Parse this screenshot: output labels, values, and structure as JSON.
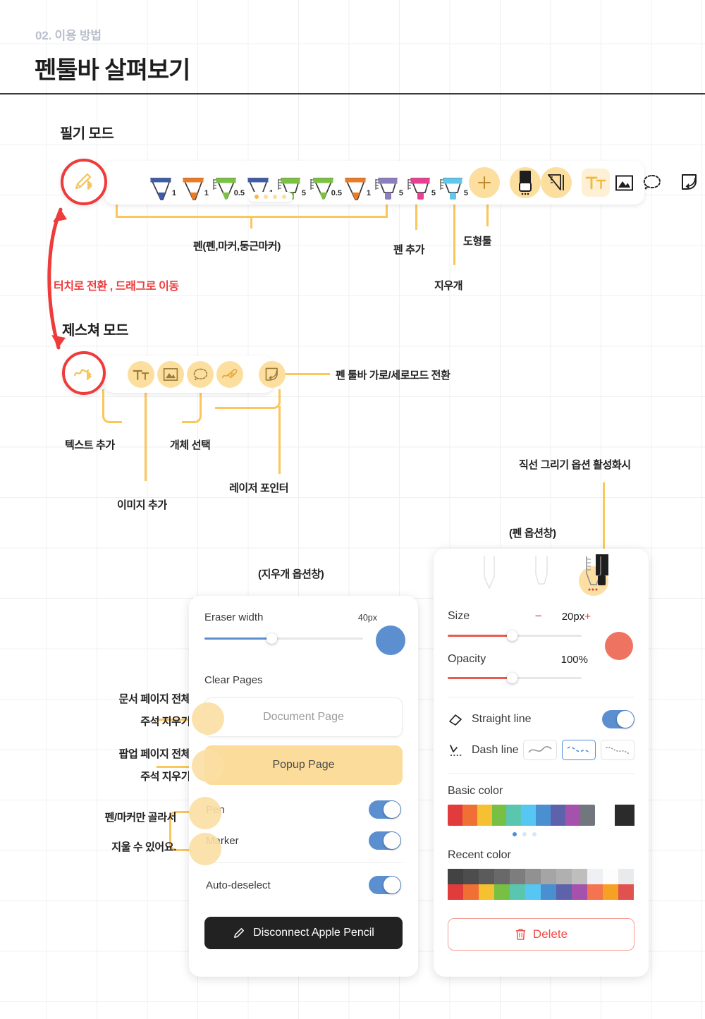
{
  "header": {
    "kicker": "02. 이용 방법",
    "title": "펜툴바 살펴보기"
  },
  "sections": {
    "writing_mode": "필기 모드",
    "gesture_mode": "제스쳐 모드"
  },
  "pen_toolbar": {
    "mode_icon": "pen-bluetooth-icon",
    "pens": [
      {
        "name": "pen",
        "color": "#3f5ca8",
        "size": "1",
        "type": "pen"
      },
      {
        "name": "pen",
        "color": "#ef7a21",
        "size": "1",
        "type": "pen"
      },
      {
        "name": "round-marker",
        "color": "#7cc242",
        "size": "0.5",
        "type": "round"
      },
      {
        "name": "pen",
        "color": "#3f5ca8",
        "size": "1",
        "type": "pen"
      },
      {
        "name": "marker",
        "color": "#7cc242",
        "size": "5",
        "type": "marker"
      },
      {
        "name": "round-marker",
        "color": "#7cc242",
        "size": "0.5",
        "type": "round"
      },
      {
        "name": "pen",
        "color": "#ef7a21",
        "size": "1",
        "type": "pen"
      },
      {
        "name": "marker",
        "color": "#8d7ec0",
        "size": "5",
        "type": "marker"
      },
      {
        "name": "marker",
        "color": "#ea3f93",
        "size": "5",
        "type": "marker"
      },
      {
        "name": "marker",
        "color": "#5ec8ee",
        "size": "5",
        "type": "marker"
      }
    ],
    "pager_dots": {
      "count": 4,
      "active_index": 0
    },
    "add_pen": "plus-icon",
    "eraser": "eraser-icon",
    "shape_tool": "ruler-triangle-icon",
    "text_tool": "text-tt-icon",
    "image_tool": "image-icon",
    "lasso_tool": "lasso-icon",
    "orientation_tool": "toolbar-orientation-icon"
  },
  "gesture_toolbar": {
    "mode_icon": "gesture-bluetooth-icon",
    "items": [
      {
        "name": "text-tt-icon"
      },
      {
        "name": "image-icon"
      },
      {
        "name": "lasso-icon"
      },
      {
        "name": "laser-pointer-icon"
      },
      {
        "name": "toolbar-orientation-icon"
      }
    ]
  },
  "annotations": {
    "pen_group": "펜(펜,마커,둥근마커)",
    "touch_switch": "터치로 전환 , 드래그로 이동",
    "add_pen": "펜 추가",
    "eraser": "지우개",
    "shape_tool": "도형툴",
    "toolbar_orientation": "펜 툴바 가로/세로모드 전환",
    "add_text": "텍스트 추가",
    "select_object": "개체 선택",
    "add_image": "이미지 추가",
    "laser_pointer": "레이저 포인터",
    "straight_line_enabled": "직선 그리기 옵션 활성화시",
    "pen_panel_caption": "(펜 옵션창)",
    "eraser_panel_caption": "(지우개 옵션창)",
    "clear_document_page": "문서 페이지 전체\n주석 지우기",
    "clear_document_page_l1": "문서 페이지 전체",
    "clear_document_page_l2": "주석 지우기",
    "clear_popup_page_l1": "팝업 페이지 전체",
    "clear_popup_page_l2": "주석 지우기",
    "pen_marker_only_l1": "펜/마커만 골라서",
    "pen_marker_only_l2": "지울 수 있어요."
  },
  "eraser_panel": {
    "width_label": "Eraser width",
    "width_value": "40px",
    "width_percent": 42,
    "preview_color": "#5b8fd0",
    "clear_pages_label": "Clear Pages",
    "document_page_button": "Document Page",
    "popup_page_button": "Popup Page",
    "pen_toggle_label": "Pen",
    "pen_toggle_on": true,
    "marker_toggle_label": "Marker",
    "marker_toggle_on": true,
    "auto_deselect_label": "Auto-deselect",
    "auto_deselect_on": true,
    "disconnect_button": "Disconnect Apple Pencil",
    "disconnect_icon": "pencil-icon"
  },
  "pen_panel": {
    "tips": [
      "pen-tip",
      "marker-tip",
      "round-marker-tip"
    ],
    "selected_tip_index": 2,
    "size_label": "Size",
    "size_minus": "−",
    "size_value": "20px",
    "size_plus": "+",
    "size_percent": 48,
    "opacity_label": "Opacity",
    "opacity_value": "100%",
    "opacity_percent": 48,
    "preview_color": "#ef7361",
    "straight_line_label": "Straight line",
    "straight_line_icon": "straight-line-icon",
    "straight_line_on": true,
    "dash_line_label": "Dash line",
    "dash_line_icon": "dash-line-icon",
    "dash_options": [
      "solid",
      "dashed",
      "dotted"
    ],
    "dash_selected_index": 1,
    "basic_color_label": "Basic color",
    "basic_colors": [
      "#e23b3b",
      "#f06f35",
      "#f5c032",
      "#77c043",
      "#5bc6b0",
      "#56c7f2",
      "#4a8fd0",
      "#5e62aa",
      "#a552ad",
      "#72777e"
    ],
    "basic_color_extra": "#2b2b2b",
    "basic_color_dots": {
      "count": 3,
      "active_index": 0
    },
    "recent_color_label": "Recent color",
    "recent_colors_row1": [
      "#434343",
      "#4d4d4d",
      "#5b5b5b",
      "#696969",
      "#7d7d7d",
      "#919191",
      "#a5a5a5",
      "#b0b0b0",
      "#bebebe",
      "#eef0f3",
      "#fdfdfd",
      "#e9eaec"
    ],
    "recent_colors_row2": [
      "#e23b3b",
      "#f06f35",
      "#f5c032",
      "#77c043",
      "#5bc6b0",
      "#56c7f2",
      "#4a8fd0",
      "#5e62aa",
      "#a552ad",
      "#f4744f",
      "#f6a124",
      "#e1524e"
    ],
    "delete_button": "Delete",
    "delete_icon": "trash-icon"
  },
  "colors": {
    "accent_yellow": "#fbc65a",
    "accent_red": "#ee3b3b",
    "amber_fill": "#fcdf9e"
  }
}
